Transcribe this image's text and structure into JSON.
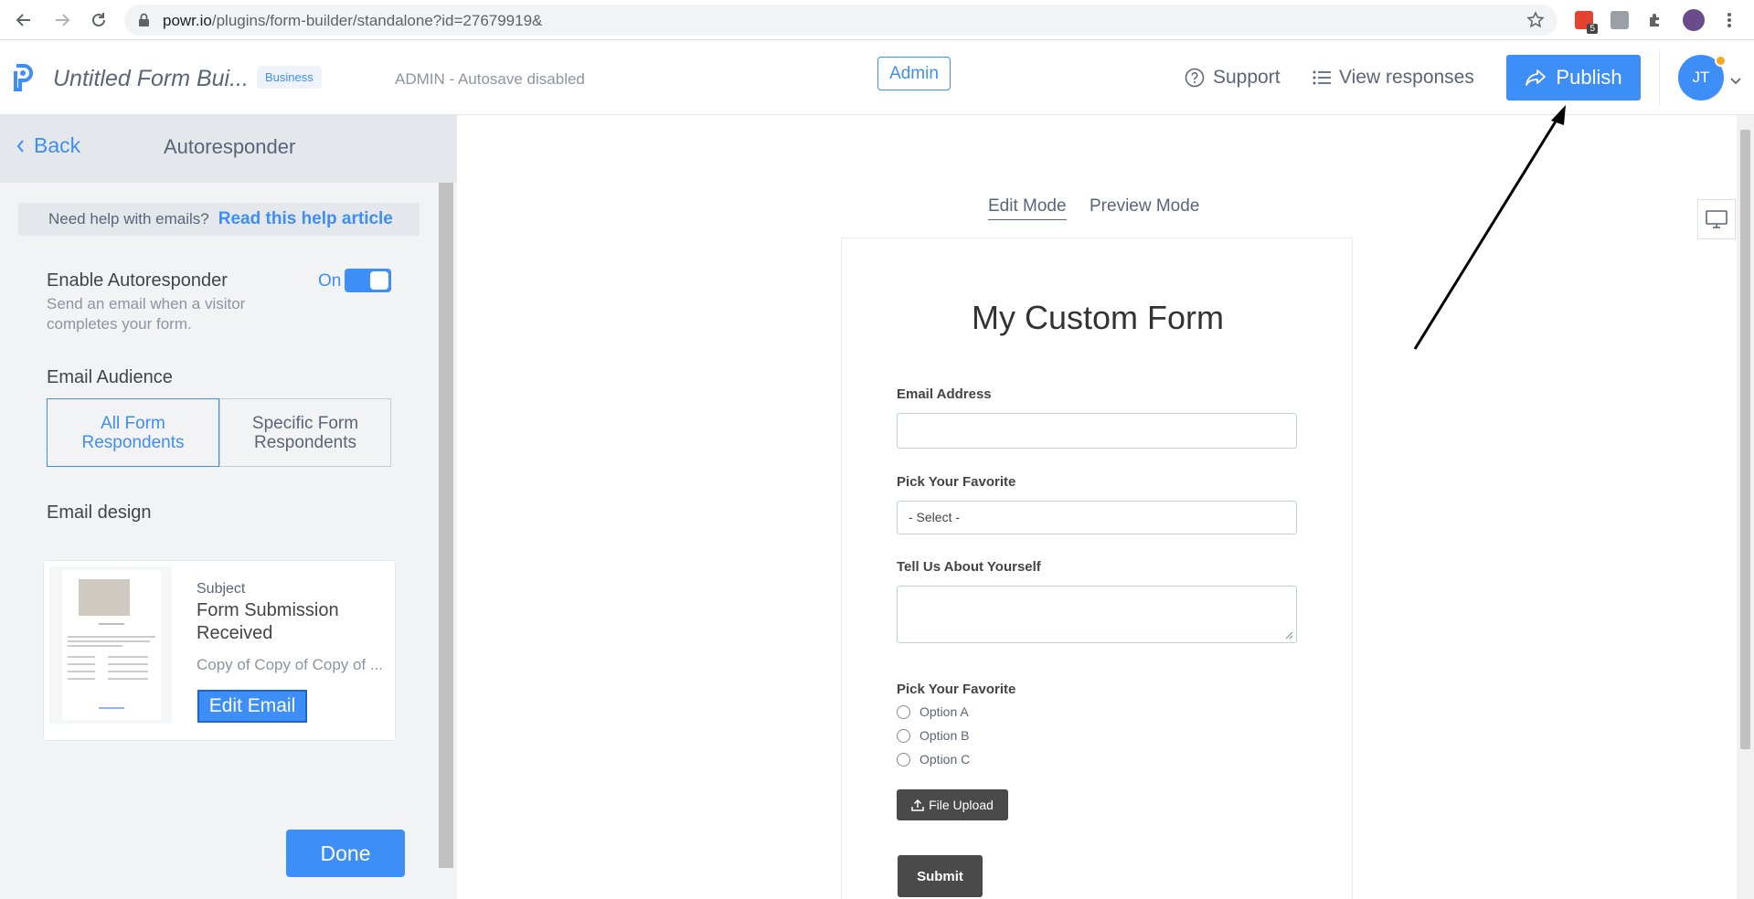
{
  "browser": {
    "url_host": "powr.io",
    "url_path": "/plugins/form-builder/standalone?id=27679919&",
    "ext_badge": "5"
  },
  "header": {
    "form_title": "Untitled Form Bui...",
    "plan_badge": "Business",
    "autosave_status": "ADMIN - Autosave disabled",
    "admin_label": "Admin",
    "support_label": "Support",
    "view_responses_label": "View responses",
    "publish_label": "Publish",
    "avatar_initials": "JT"
  },
  "panel": {
    "back_label": "Back",
    "title": "Autoresponder",
    "help_text": "Need help with emails?",
    "help_link": "Read this help article",
    "enable_title": "Enable Autoresponder",
    "enable_sub": "Send an email when a visitor completes your form.",
    "toggle_label": "On",
    "audience_title": "Email Audience",
    "audience_options": [
      "All Form Respondents",
      "Specific Form Respondents"
    ],
    "design_title": "Email design",
    "subject_label": "Subject",
    "subject_value": "Form Submission Received",
    "copy_text": "Copy of Copy of Copy of ...",
    "edit_email_label": "Edit Email",
    "done_label": "Done"
  },
  "main": {
    "mode_edit": "Edit Mode",
    "mode_preview": "Preview Mode",
    "form": {
      "heading": "My Custom Form",
      "email_label": "Email Address",
      "pick_label": "Pick Your Favorite",
      "select_value": "- Select -",
      "tell_label": "Tell Us About Yourself",
      "radio_label": "Pick Your Favorite",
      "radio_options": [
        "Option A",
        "Option B",
        "Option C"
      ],
      "file_upload_label": "File Upload",
      "submit_label": "Submit"
    }
  },
  "colors": {
    "accent": "#3e8ef7",
    "panel_bg": "#f2f3f5",
    "dark_button": "#4a4a4a"
  }
}
